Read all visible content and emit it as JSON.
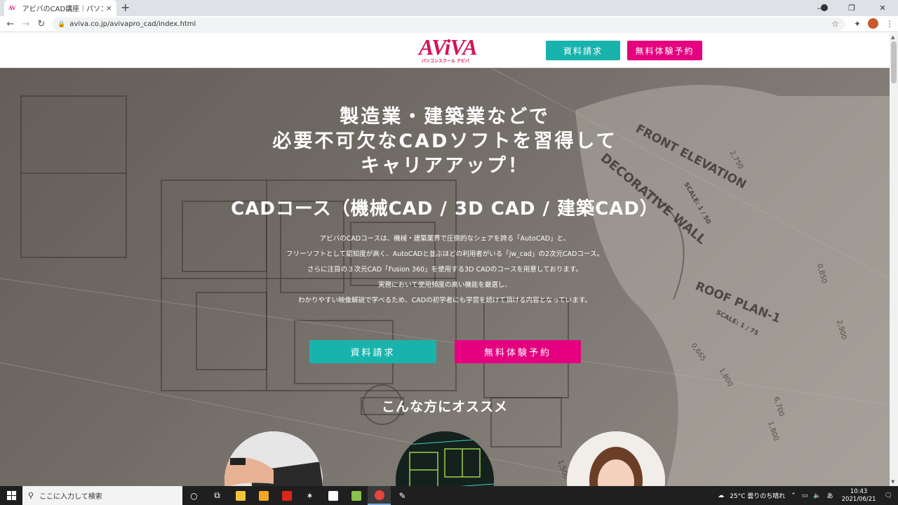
{
  "browser": {
    "tab_title": "アビバのCAD講座｜パソコン教室・パ",
    "tab_close": "×",
    "new_tab": "+",
    "url": "aviva.co.jp/avivapro_cad/index.html",
    "back": "←",
    "forward": "→",
    "reload": "↻",
    "minimize": "—",
    "maximize": "❐",
    "close": "✕"
  },
  "header": {
    "logo_text": "AViVA",
    "logo_sub": "パソコンスクール アビバ",
    "btn_request": "資料請求",
    "btn_trial": "無料体験予約"
  },
  "hero": {
    "headline": [
      "製造業・建築業などで",
      "必要不可欠なCADソフトを習得して",
      "キャリアアップ！"
    ],
    "course_title": "CADコース（機械CAD / 3D CAD / 建築CAD）",
    "description": [
      "アビバのCADコースは、機械・建築業界で圧倒的なシェアを誇る「AutoCAD」と、",
      "フリーソフトとして認知度が高く、AutoCADと並ぶほどの利用者がいる「jw_cad」の2次元CADコース。",
      "さらに注目の３次元CAD「Fusion 360」を使用する3D CADのコースを用意しております。",
      "実務において使用頻度の高い機能を厳選し、",
      "わかりやすい映像解説で学べるため、CADの初学者にも学習を続けて頂ける内容となっています。"
    ],
    "btn_request": "資料請求",
    "btn_trial": "無料体験予約",
    "section_title": "こんな方にオススメ"
  },
  "blueprint_labels": {
    "front": "FRONT ELEVATION",
    "decorative": "DECORATIVE WALL",
    "scale50": "SCALE: 1 / 50",
    "roof": "ROOF PLAN-1",
    "scale75": "SCALE: 1 / 75",
    "d2750": "2,750",
    "d0850": "0,850",
    "d2900": "2,900",
    "d0665": "0,665",
    "d1800": "1,800",
    "d6700": "6,700",
    "d1800b": "1,800",
    "d1500": "1,500"
  },
  "taskbar": {
    "search_placeholder": "ここに入力して検索",
    "weather": "25°C  曇りのち晴れ",
    "ime": "あ",
    "time": "10:43",
    "date": "2021/06/21"
  },
  "colors": {
    "teal": "#19b3ad",
    "pink": "#e4007f",
    "brand": "#d4145a"
  }
}
